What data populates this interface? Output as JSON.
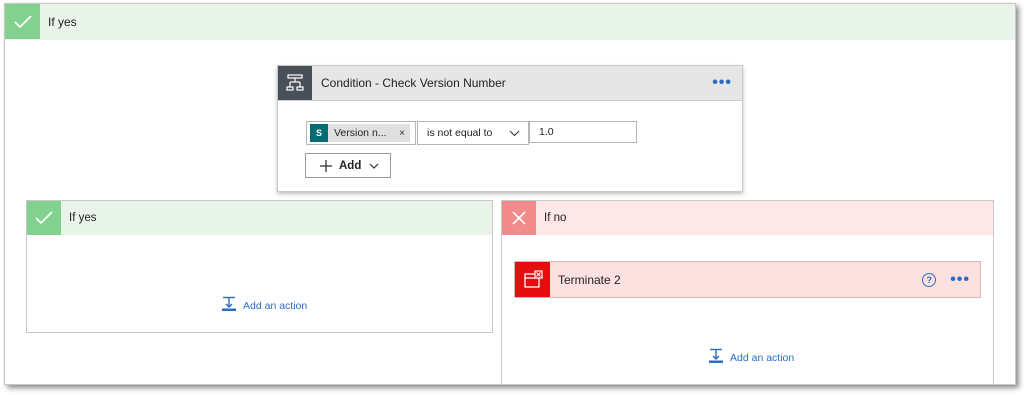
{
  "top_branch": {
    "label": "If yes",
    "icon": "check-icon",
    "color": "#82d18f"
  },
  "condition": {
    "title": "Condition - Check Version Number",
    "icon": "condition-icon",
    "menu_label": "•••",
    "row": {
      "token": {
        "icon": "sharepoint-icon",
        "icon_text": "S",
        "label": "Version n...",
        "remove": "×"
      },
      "operator": {
        "value": "is not equal to"
      },
      "value": "1.0"
    },
    "add_button": {
      "label": "Add"
    }
  },
  "branch_yes": {
    "label": "If yes",
    "icon": "check-icon",
    "add_action": "Add an action"
  },
  "branch_no": {
    "label": "If no",
    "icon": "close-icon",
    "action": {
      "title": "Terminate 2",
      "icon": "terminate-icon",
      "help": "?",
      "menu_label": "•••"
    },
    "add_action": "Add an action"
  },
  "colors": {
    "accent": "#2b6cc4",
    "yes_bg": "#e8f4ea",
    "no_bg": "#fde7e7",
    "terminate_red": "#e40e0e",
    "condition_icon_bg": "#484f58"
  }
}
